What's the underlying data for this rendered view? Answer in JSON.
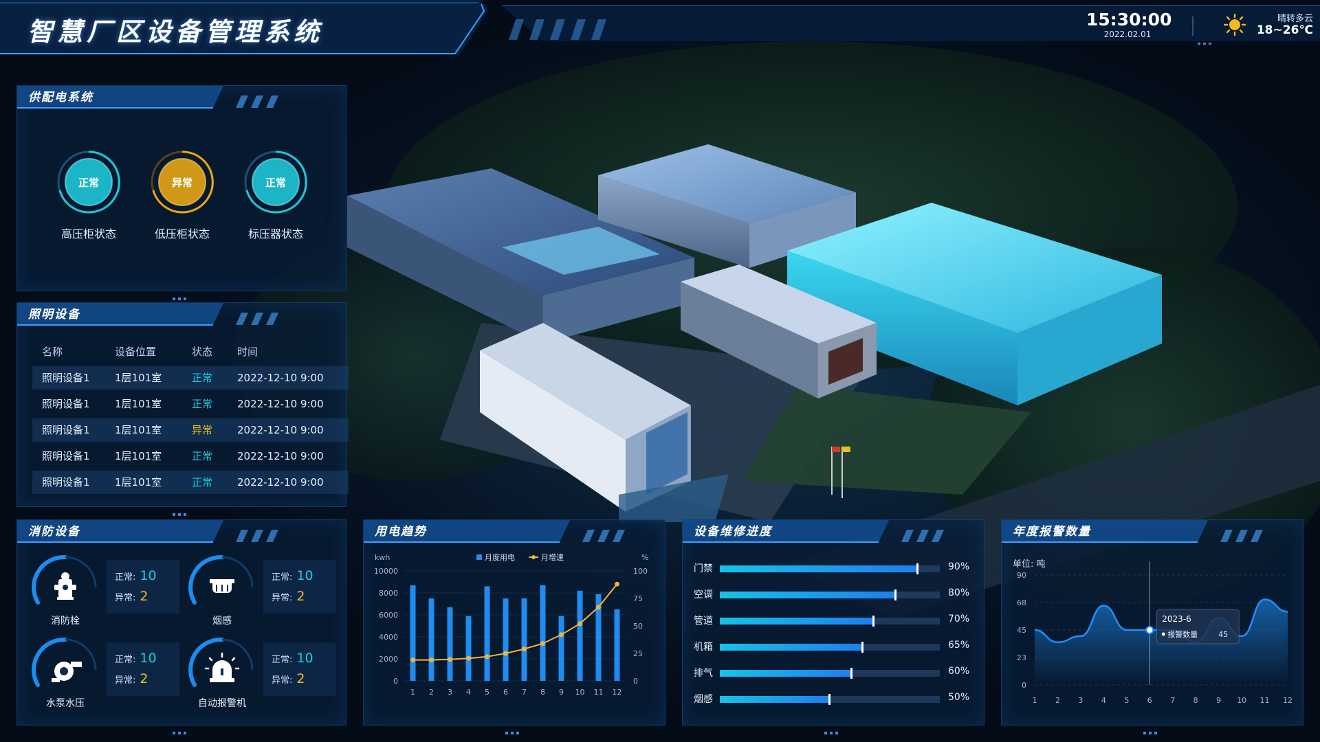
{
  "header": {
    "title": "智慧厂区设备管理系统",
    "time": "15:30:00",
    "date": "2022.02.01",
    "weather": {
      "icon": "sun-icon",
      "desc": "晴转多云",
      "temp": "18~26℃"
    }
  },
  "power": {
    "title": "供配电系统",
    "items": [
      {
        "state": "正常",
        "label": "高压柜状态",
        "color": "#1fc6d8"
      },
      {
        "state": "异常",
        "label": "低压柜状态",
        "color": "#e8a514"
      },
      {
        "state": "正常",
        "label": "标压器状态",
        "color": "#1fc6d8"
      }
    ]
  },
  "lighting": {
    "title": "照明设备",
    "headers": [
      "名称",
      "设备位置",
      "状态",
      "时间"
    ],
    "rows": [
      {
        "name": "照明设备1",
        "location": "1层101室",
        "status": "正常",
        "time": "2022-12-10 9:00"
      },
      {
        "name": "照明设备1",
        "location": "1层101室",
        "status": "正常",
        "time": "2022-12-10 9:00"
      },
      {
        "name": "照明设备1",
        "location": "1层101室",
        "status": "异常",
        "time": "2022-12-10 9:00"
      },
      {
        "name": "照明设备1",
        "location": "1层101室",
        "status": "正常",
        "time": "2022-12-10 9:00"
      },
      {
        "name": "照明设备1",
        "location": "1层101室",
        "status": "正常",
        "time": "2022-12-10 9:00"
      }
    ],
    "status_colors": {
      "正常": "#18d0e0",
      "异常": "#f0c020"
    }
  },
  "fire": {
    "title": "消防设备",
    "normal_label": "正常:",
    "abnormal_label": "异常:",
    "items": [
      {
        "label": "消防栓",
        "icon": "fire-hydrant-icon",
        "normal": "10",
        "abnormal": "2"
      },
      {
        "label": "烟感",
        "icon": "smoke-detector-icon",
        "normal": "10",
        "abnormal": "2"
      },
      {
        "label": "水泵水压",
        "icon": "water-pump-icon",
        "normal": "10",
        "abnormal": "2"
      },
      {
        "label": "自动报警机",
        "icon": "alarm-light-icon",
        "normal": "10",
        "abnormal": "2"
      }
    ]
  },
  "maintenance": {
    "title": "设备维修进度",
    "items": [
      {
        "label": "门禁",
        "percent": 90,
        "value": "90%"
      },
      {
        "label": "空调",
        "percent": 80,
        "value": "80%"
      },
      {
        "label": "管道",
        "percent": 70,
        "value": "70%"
      },
      {
        "label": "机箱",
        "percent": 65,
        "value": "65%"
      },
      {
        "label": "排气",
        "percent": 60,
        "value": "60%"
      },
      {
        "label": "烟感",
        "percent": 50,
        "value": "50%"
      }
    ]
  },
  "chart_data": [
    {
      "type": "bar",
      "panel_title": "用电趋势",
      "y_unit": "kwh",
      "y2_unit": "%",
      "categories": [
        "1",
        "2",
        "3",
        "4",
        "5",
        "6",
        "7",
        "8",
        "9",
        "10",
        "11",
        "12"
      ],
      "ylim": [
        0,
        10000
      ],
      "yticks": [
        "0",
        "2000",
        "4000",
        "6000",
        "8000",
        "10000"
      ],
      "y2lim": [
        0,
        100
      ],
      "y2ticks": [
        "0",
        "25",
        "50",
        "75",
        "100"
      ],
      "legend": [
        "月度用电",
        "月增速"
      ],
      "series": [
        {
          "name": "月度用电",
          "type": "bar",
          "values": [
            8700,
            7500,
            6700,
            5900,
            8600,
            7500,
            7500,
            8700,
            5900,
            8200,
            7900,
            6500
          ]
        },
        {
          "name": "月增速",
          "type": "line",
          "values": [
            19,
            19,
            19.5,
            20.5,
            22,
            25,
            29,
            34,
            42,
            52,
            67,
            88
          ]
        }
      ]
    },
    {
      "type": "area",
      "panel_title": "年度报警数量",
      "unit_label": "单位: 吨",
      "x": [
        "1",
        "2",
        "3",
        "4",
        "5",
        "6",
        "7",
        "8",
        "9",
        "10",
        "11",
        "12"
      ],
      "ylim": [
        0,
        90
      ],
      "yticks": [
        "0",
        "23",
        "45",
        "68",
        "90"
      ],
      "series": [
        {
          "name": "报警数量",
          "values": [
            45,
            35,
            40,
            65,
            45,
            45,
            45,
            35,
            55,
            40,
            70,
            60
          ]
        }
      ],
      "tooltip": {
        "title": "2023-6",
        "label": "报警数量",
        "value": "45"
      }
    }
  ]
}
